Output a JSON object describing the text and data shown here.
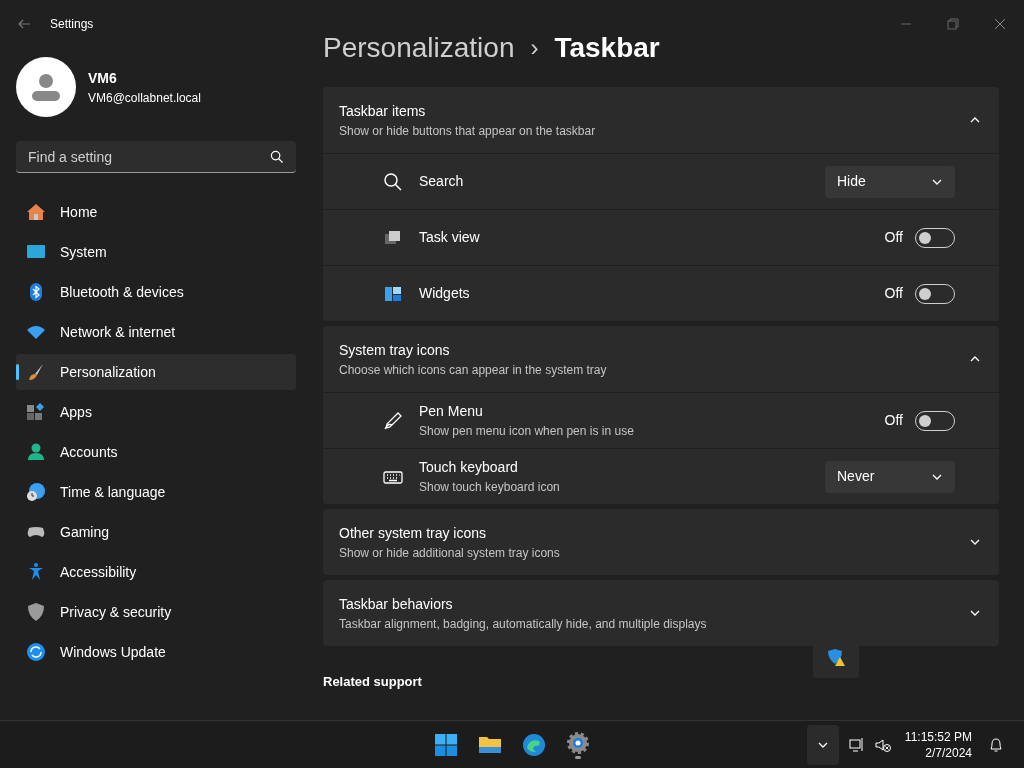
{
  "window": {
    "title": "Settings"
  },
  "account": {
    "name": "VM6",
    "email": "VM6@collabnet.local"
  },
  "search": {
    "placeholder": "Find a setting"
  },
  "sidebar": {
    "items": [
      {
        "label": "Home",
        "selected": false
      },
      {
        "label": "System",
        "selected": false
      },
      {
        "label": "Bluetooth & devices",
        "selected": false
      },
      {
        "label": "Network & internet",
        "selected": false
      },
      {
        "label": "Personalization",
        "selected": true
      },
      {
        "label": "Apps",
        "selected": false
      },
      {
        "label": "Accounts",
        "selected": false
      },
      {
        "label": "Time & language",
        "selected": false
      },
      {
        "label": "Gaming",
        "selected": false
      },
      {
        "label": "Accessibility",
        "selected": false
      },
      {
        "label": "Privacy & security",
        "selected": false
      },
      {
        "label": "Windows Update",
        "selected": false
      }
    ]
  },
  "breadcrumb": {
    "parent": "Personalization",
    "separator": "›",
    "current": "Taskbar"
  },
  "sections": [
    {
      "title": "Taskbar items",
      "subtitle": "Show or hide buttons that appear on the taskbar",
      "expanded": true,
      "rows": [
        {
          "kind": "dropdown",
          "label": "Search",
          "value": "Hide"
        },
        {
          "kind": "toggle",
          "label": "Task view",
          "state_text": "Off",
          "on": false
        },
        {
          "kind": "toggle",
          "label": "Widgets",
          "state_text": "Off",
          "on": false
        }
      ]
    },
    {
      "title": "System tray icons",
      "subtitle": "Choose which icons can appear in the system tray",
      "expanded": true,
      "rows": [
        {
          "kind": "toggle",
          "label": "Pen Menu",
          "description": "Show pen menu icon when pen is in use",
          "state_text": "Off",
          "on": false
        },
        {
          "kind": "dropdown",
          "label": "Touch keyboard",
          "description": "Show touch keyboard icon",
          "value": "Never"
        }
      ]
    },
    {
      "title": "Other system tray icons",
      "subtitle": "Show or hide additional system tray icons",
      "expanded": false
    },
    {
      "title": "Taskbar behaviors",
      "subtitle": "Taskbar alignment, badging, automatically hide, and multiple displays",
      "expanded": false
    }
  ],
  "related": {
    "title": "Related support"
  },
  "taskbar": {
    "time": "11:15:52 PM",
    "date": "2/7/2024"
  }
}
